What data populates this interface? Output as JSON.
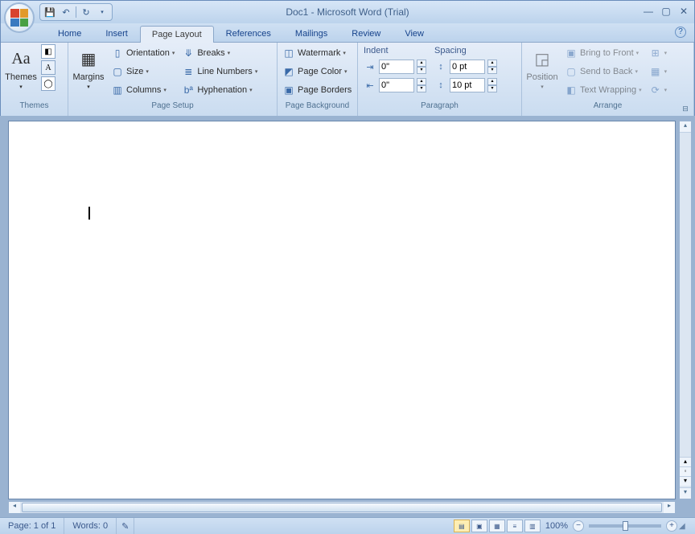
{
  "title": "Doc1 - Microsoft Word (Trial)",
  "tabs": {
    "home": "Home",
    "insert": "Insert",
    "pagelayout": "Page Layout",
    "references": "References",
    "mailings": "Mailings",
    "review": "Review",
    "view": "View"
  },
  "groups": {
    "themes": "Themes",
    "pagesetup": "Page Setup",
    "pagebackground": "Page Background",
    "paragraph": "Paragraph",
    "arrange": "Arrange"
  },
  "cmd": {
    "themes": "Themes",
    "margins": "Margins",
    "orientation": "Orientation",
    "size": "Size",
    "columns": "Columns",
    "breaks": "Breaks",
    "linenumbers": "Line Numbers",
    "hyphenation": "Hyphenation",
    "watermark": "Watermark",
    "pagecolor": "Page Color",
    "pageborders": "Page Borders",
    "position": "Position",
    "bringfront": "Bring to Front",
    "sendback": "Send to Back",
    "textwrap": "Text Wrapping"
  },
  "paragraph": {
    "indent_label": "Indent",
    "spacing_label": "Spacing",
    "indent_left": "0\"",
    "indent_right": "0\"",
    "space_before": "0 pt",
    "space_after": "10 pt"
  },
  "status": {
    "page": "Page: 1 of 1",
    "words": "Words: 0",
    "zoom": "100%"
  }
}
